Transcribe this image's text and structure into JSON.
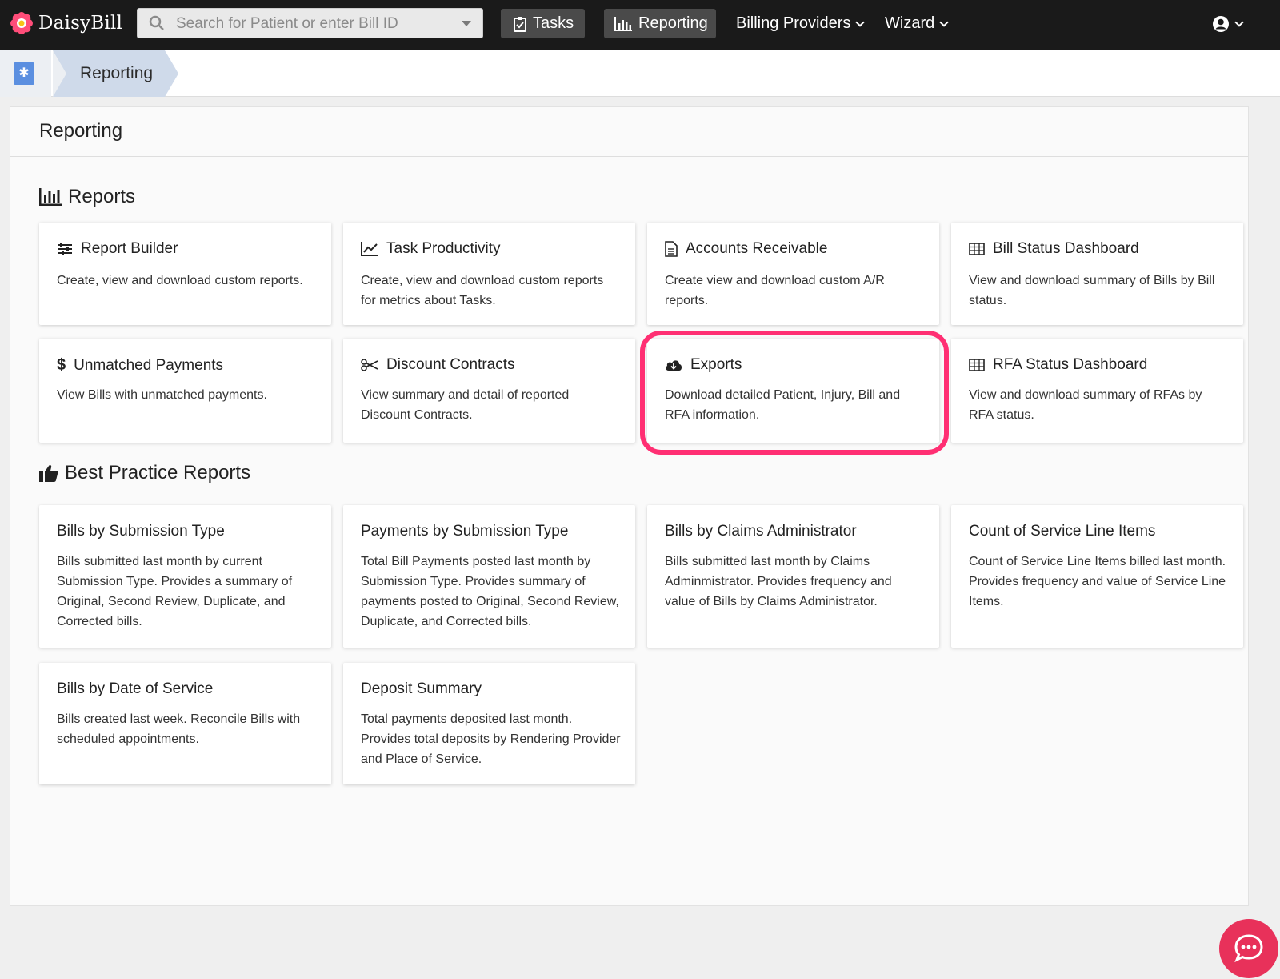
{
  "nav": {
    "brand": "DaisyBill",
    "search_placeholder": "Search for Patient or enter Bill ID",
    "tasks": "Tasks",
    "reporting": "Reporting",
    "billing_providers": "Billing Providers",
    "wizard": "Wizard"
  },
  "breadcrumb": {
    "current": "Reporting"
  },
  "page": {
    "title": "Reporting"
  },
  "reports": {
    "heading": "Reports",
    "cards": [
      {
        "title": "Report Builder",
        "desc": "Create, view and download custom reports."
      },
      {
        "title": "Task Productivity",
        "desc": "Create, view and download custom reports for metrics about Tasks."
      },
      {
        "title": "Accounts Receivable",
        "desc": "Create view and download custom A/R reports."
      },
      {
        "title": "Bill Status Dashboard",
        "desc": "View and download summary of Bills by Bill status."
      },
      {
        "title": "Unmatched Payments",
        "desc": "View Bills with unmatched payments."
      },
      {
        "title": "Discount Contracts",
        "desc": "View summary and detail of reported Discount Contracts."
      },
      {
        "title": "Exports",
        "desc": "Download detailed Patient, Injury, Bill and RFA information."
      },
      {
        "title": "RFA Status Dashboard",
        "desc": "View and download summary of RFAs by RFA status."
      }
    ]
  },
  "best_practice": {
    "heading": "Best Practice Reports",
    "cards": [
      {
        "title": "Bills by Submission Type",
        "desc": "Bills submitted last month by current Submission Type. Provides a summary of Original, Second Review, Duplicate, and Corrected bills."
      },
      {
        "title": "Payments by Submission Type",
        "desc": "Total Bill Payments posted last month by Submission Type. Provides summary of payments posted to Original, Second Review, Duplicate, and Corrected bills."
      },
      {
        "title": "Bills by Claims Administrator",
        "desc": "Bills submitted last month by Claims Adminmistrator. Provides frequency and value of Bills by Claims Administrator."
      },
      {
        "title": "Count of Service Line Items",
        "desc": "Count of Service Line Items billed last month. Provides frequency and value of Service Line Items."
      },
      {
        "title": "Bills by Date of Service",
        "desc": "Bills created last week. Reconcile Bills with scheduled appointments."
      },
      {
        "title": "Deposit Summary",
        "desc": "Total payments deposited last month. Provides total deposits by Rendering Provider and Place of Service."
      }
    ]
  },
  "colors": {
    "highlight": "#ff2f73",
    "chat": "#e8315a",
    "nav_bg": "#1a1a1a"
  }
}
